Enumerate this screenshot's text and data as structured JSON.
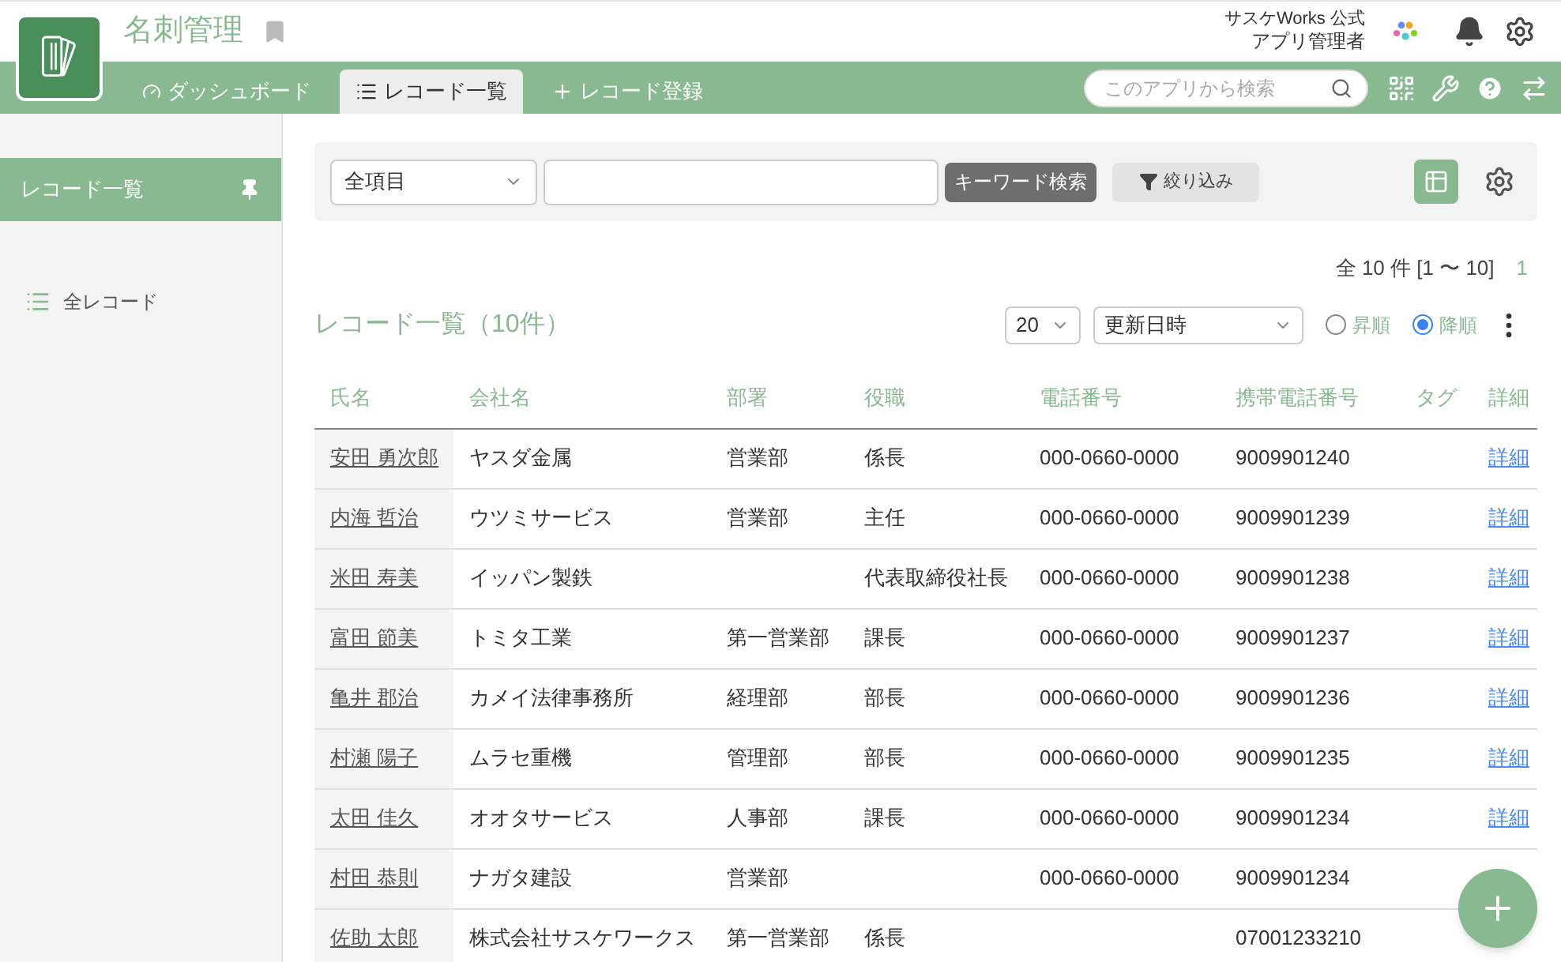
{
  "app": {
    "title": "名刺管理",
    "bookmarked": false
  },
  "user": {
    "org": "サスケWorks 公式",
    "name": "アプリ管理者"
  },
  "nav_tabs": [
    {
      "label": "ダッシュボード",
      "kind": "dashboard",
      "selected": false
    },
    {
      "label": "レコード一覧",
      "kind": "list",
      "selected": true
    },
    {
      "label": "レコード登録",
      "kind": "add",
      "selected": false
    }
  ],
  "search": {
    "placeholder": "このアプリから検索"
  },
  "sidebar": {
    "header": "レコード一覧",
    "items": [
      {
        "label": "全レコード",
        "selected": false
      }
    ]
  },
  "filter": {
    "field": "全項目",
    "search_button": "キーワード検索",
    "filter_button": "絞り込み"
  },
  "summary": {
    "count": "全 10 件 [1 〜 10]",
    "page": "1"
  },
  "list": {
    "title": "レコード一覧（10件）",
    "per_page": "20",
    "sort_field": "更新日時",
    "sort_order": [
      {
        "label": "昇順",
        "selected": false
      },
      {
        "label": "降順",
        "selected": true
      }
    ]
  },
  "table": {
    "columns": [
      "氏名",
      "会社名",
      "部署",
      "役職",
      "電話番号",
      "携帯電話番号",
      "タグ",
      "詳細"
    ],
    "rows": [
      [
        "安田 勇次郎",
        "ヤスダ金属",
        "営業部",
        "係長",
        "000-0660-0000",
        "9009901240",
        "",
        "詳細"
      ],
      [
        "内海 哲治",
        "ウツミサービス",
        "営業部",
        "主任",
        "000-0660-0000",
        "9009901239",
        "",
        "詳細"
      ],
      [
        "米田 寿美",
        "イッパン製鉄",
        "",
        "代表取締役社長",
        "000-0660-0000",
        "9009901238",
        "",
        "詳細"
      ],
      [
        "富田 節美",
        "トミタ工業",
        "第一営業部",
        "課長",
        "000-0660-0000",
        "9009901237",
        "",
        "詳細"
      ],
      [
        "亀井 郡治",
        "カメイ法律事務所",
        "経理部",
        "部長",
        "000-0660-0000",
        "9009901236",
        "",
        "詳細"
      ],
      [
        "村瀬 陽子",
        "ムラセ重機",
        "管理部",
        "部長",
        "000-0660-0000",
        "9009901235",
        "",
        "詳細"
      ],
      [
        "太田 佳久",
        "オオタサービス",
        "人事部",
        "課長",
        "000-0660-0000",
        "9009901234",
        "",
        "詳細"
      ],
      [
        "村田 恭則",
        "ナガタ建設",
        "営業部",
        "",
        "000-0660-0000",
        "9009901234",
        "",
        null
      ],
      [
        "佐助 太郎",
        "株式会社サスケワークス",
        "第一営業部",
        "係長",
        "",
        "07001233210",
        "",
        null
      ]
    ]
  }
}
